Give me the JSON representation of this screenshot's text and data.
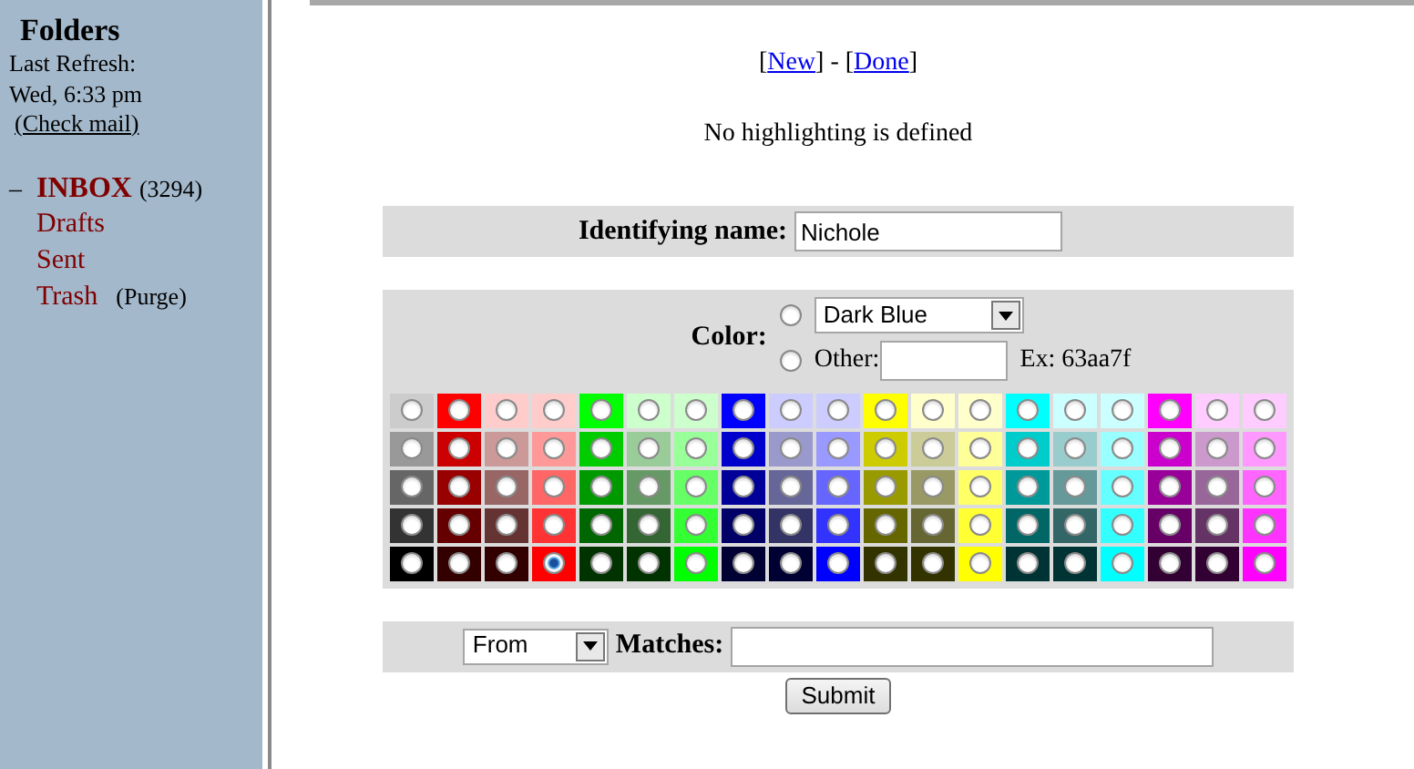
{
  "sidebar": {
    "title": "Folders",
    "refresh_label": "Last Refresh:",
    "refresh_time": "Wed, 6:33 pm",
    "check_mail": "(Check mail)",
    "folders": [
      {
        "toggle": "–",
        "name": "INBOX",
        "count": "(3294)",
        "unread": true
      },
      {
        "name": "Drafts",
        "unread": false
      },
      {
        "name": "Sent",
        "unread": false
      },
      {
        "name": "Trash",
        "action": "(Purge)",
        "unread": false
      }
    ]
  },
  "nav": [
    {
      "kind": "text",
      "text": "["
    },
    {
      "kind": "link",
      "text": "New"
    },
    {
      "kind": "text",
      "text": "] - ["
    },
    {
      "kind": "link",
      "text": "Done"
    },
    {
      "kind": "text",
      "text": "]"
    }
  ],
  "message": "No highlighting is defined",
  "name_row": {
    "label": "Identifying name:",
    "value": "Nichole"
  },
  "color": {
    "label": "Color:",
    "options": [
      {
        "kind": "select",
        "selected": false,
        "value": "Dark Blue"
      },
      {
        "kind": "other",
        "selected": false,
        "label": "Other:",
        "hint": "Ex: 63aa7f"
      }
    ],
    "palette": [
      [
        {
          "color": "#cccccc",
          "selected": false
        },
        {
          "color": "#ff0000",
          "selected": false
        },
        {
          "color": "#ffcccc",
          "selected": false
        },
        {
          "color": "#ffcccc",
          "selected": false
        },
        {
          "color": "#00ff00",
          "selected": false
        },
        {
          "color": "#ccffcc",
          "selected": false
        },
        {
          "color": "#ccffcc",
          "selected": false
        },
        {
          "color": "#0000ff",
          "selected": false
        },
        {
          "color": "#ccccff",
          "selected": false
        },
        {
          "color": "#ccccff",
          "selected": false
        },
        {
          "color": "#ffff00",
          "selected": false
        },
        {
          "color": "#ffffcc",
          "selected": false
        },
        {
          "color": "#ffffcc",
          "selected": false
        },
        {
          "color": "#00ffff",
          "selected": false
        },
        {
          "color": "#ccffff",
          "selected": false
        },
        {
          "color": "#ccffff",
          "selected": false
        },
        {
          "color": "#ff00ff",
          "selected": false
        },
        {
          "color": "#ffccff",
          "selected": false
        },
        {
          "color": "#ffccff",
          "selected": false
        }
      ],
      [
        {
          "color": "#999999",
          "selected": false
        },
        {
          "color": "#cc0000",
          "selected": false
        },
        {
          "color": "#cc9999",
          "selected": false
        },
        {
          "color": "#ff9999",
          "selected": false
        },
        {
          "color": "#00cc00",
          "selected": false
        },
        {
          "color": "#99cc99",
          "selected": false
        },
        {
          "color": "#99ff99",
          "selected": false
        },
        {
          "color": "#0000cc",
          "selected": false
        },
        {
          "color": "#9999cc",
          "selected": false
        },
        {
          "color": "#9999ff",
          "selected": false
        },
        {
          "color": "#cccc00",
          "selected": false
        },
        {
          "color": "#cccc99",
          "selected": false
        },
        {
          "color": "#ffff99",
          "selected": false
        },
        {
          "color": "#00cccc",
          "selected": false
        },
        {
          "color": "#99cccc",
          "selected": false
        },
        {
          "color": "#99ffff",
          "selected": false
        },
        {
          "color": "#cc00cc",
          "selected": false
        },
        {
          "color": "#cc99cc",
          "selected": false
        },
        {
          "color": "#ff99ff",
          "selected": false
        }
      ],
      [
        {
          "color": "#666666",
          "selected": false
        },
        {
          "color": "#990000",
          "selected": false
        },
        {
          "color": "#996666",
          "selected": false
        },
        {
          "color": "#ff6666",
          "selected": false
        },
        {
          "color": "#009900",
          "selected": false
        },
        {
          "color": "#669966",
          "selected": false
        },
        {
          "color": "#66ff66",
          "selected": false
        },
        {
          "color": "#000099",
          "selected": false
        },
        {
          "color": "#666699",
          "selected": false
        },
        {
          "color": "#6666ff",
          "selected": false
        },
        {
          "color": "#999900",
          "selected": false
        },
        {
          "color": "#999966",
          "selected": false
        },
        {
          "color": "#ffff66",
          "selected": false
        },
        {
          "color": "#009999",
          "selected": false
        },
        {
          "color": "#669999",
          "selected": false
        },
        {
          "color": "#66ffff",
          "selected": false
        },
        {
          "color": "#990099",
          "selected": false
        },
        {
          "color": "#996699",
          "selected": false
        },
        {
          "color": "#ff66ff",
          "selected": false
        }
      ],
      [
        {
          "color": "#333333",
          "selected": false
        },
        {
          "color": "#660000",
          "selected": false
        },
        {
          "color": "#663333",
          "selected": false
        },
        {
          "color": "#ff3333",
          "selected": false
        },
        {
          "color": "#006600",
          "selected": false
        },
        {
          "color": "#336633",
          "selected": false
        },
        {
          "color": "#33ff33",
          "selected": false
        },
        {
          "color": "#000066",
          "selected": false
        },
        {
          "color": "#333366",
          "selected": false
        },
        {
          "color": "#3333ff",
          "selected": false
        },
        {
          "color": "#666600",
          "selected": false
        },
        {
          "color": "#666633",
          "selected": false
        },
        {
          "color": "#ffff33",
          "selected": false
        },
        {
          "color": "#006666",
          "selected": false
        },
        {
          "color": "#336666",
          "selected": false
        },
        {
          "color": "#33ffff",
          "selected": false
        },
        {
          "color": "#660066",
          "selected": false
        },
        {
          "color": "#663366",
          "selected": false
        },
        {
          "color": "#ff33ff",
          "selected": false
        }
      ],
      [
        {
          "color": "#000000",
          "selected": false
        },
        {
          "color": "#330000",
          "selected": false
        },
        {
          "color": "#330000",
          "selected": false
        },
        {
          "color": "#ff0000",
          "selected": true
        },
        {
          "color": "#003300",
          "selected": false
        },
        {
          "color": "#003300",
          "selected": false
        },
        {
          "color": "#00ff00",
          "selected": false
        },
        {
          "color": "#000033",
          "selected": false
        },
        {
          "color": "#000033",
          "selected": false
        },
        {
          "color": "#0000ff",
          "selected": false
        },
        {
          "color": "#333300",
          "selected": false
        },
        {
          "color": "#333300",
          "selected": false
        },
        {
          "color": "#ffff00",
          "selected": false
        },
        {
          "color": "#003333",
          "selected": false
        },
        {
          "color": "#003333",
          "selected": false
        },
        {
          "color": "#00ffff",
          "selected": false
        },
        {
          "color": "#330033",
          "selected": false
        },
        {
          "color": "#330033",
          "selected": false
        },
        {
          "color": "#ff00ff",
          "selected": false
        }
      ]
    ]
  },
  "match_row": {
    "field": "From",
    "label": "Matches:"
  },
  "submit": "Submit"
}
